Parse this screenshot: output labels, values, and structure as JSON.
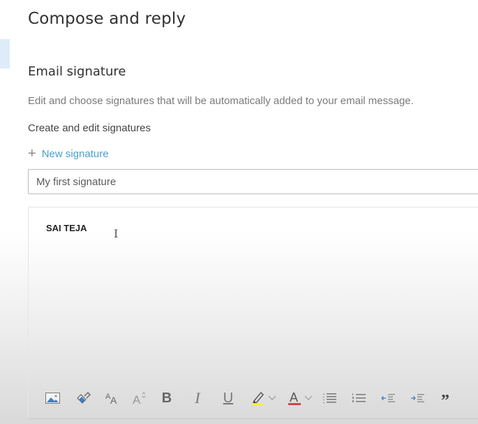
{
  "page": {
    "title": "Compose and reply"
  },
  "signature": {
    "section_title": "Email signature",
    "description": "Edit and choose signatures that will be automatically added to your email message.",
    "create_edit_title": "Create and edit signatures",
    "new_signature_label": "New signature",
    "new_signature_icon": "plus-icon",
    "name_value": "My first signature",
    "body_text": "SAI TEJA"
  },
  "toolbar": {
    "items": [
      {
        "name": "insert-picture",
        "icon": "image-icon"
      },
      {
        "name": "format-painter",
        "icon": "paintbrush-icon"
      },
      {
        "name": "font-size",
        "icon": "font-size-icon"
      },
      {
        "name": "grow-font",
        "icon": "grow-font-icon"
      },
      {
        "name": "bold",
        "icon": "bold-icon",
        "glyph": "B"
      },
      {
        "name": "italic",
        "icon": "italic-icon",
        "glyph": "I"
      },
      {
        "name": "underline",
        "icon": "underline-icon",
        "glyph": "U"
      },
      {
        "name": "highlight",
        "icon": "highlighter-icon",
        "has_dropdown": true
      },
      {
        "name": "font-color",
        "icon": "font-color-icon",
        "glyph": "A",
        "has_dropdown": true
      },
      {
        "name": "bullets",
        "icon": "bulleted-list-icon"
      },
      {
        "name": "numbering",
        "icon": "numbered-list-icon"
      },
      {
        "name": "decrease-indent",
        "icon": "decrease-indent-icon"
      },
      {
        "name": "increase-indent",
        "icon": "increase-indent-icon"
      },
      {
        "name": "quote",
        "icon": "quote-icon",
        "glyph": "”"
      }
    ]
  },
  "colors": {
    "accent_link": "#4a9fc9",
    "highlight": "#f5ee3a",
    "font_color": "#d0464b",
    "nav_selected": "#deecf9"
  }
}
